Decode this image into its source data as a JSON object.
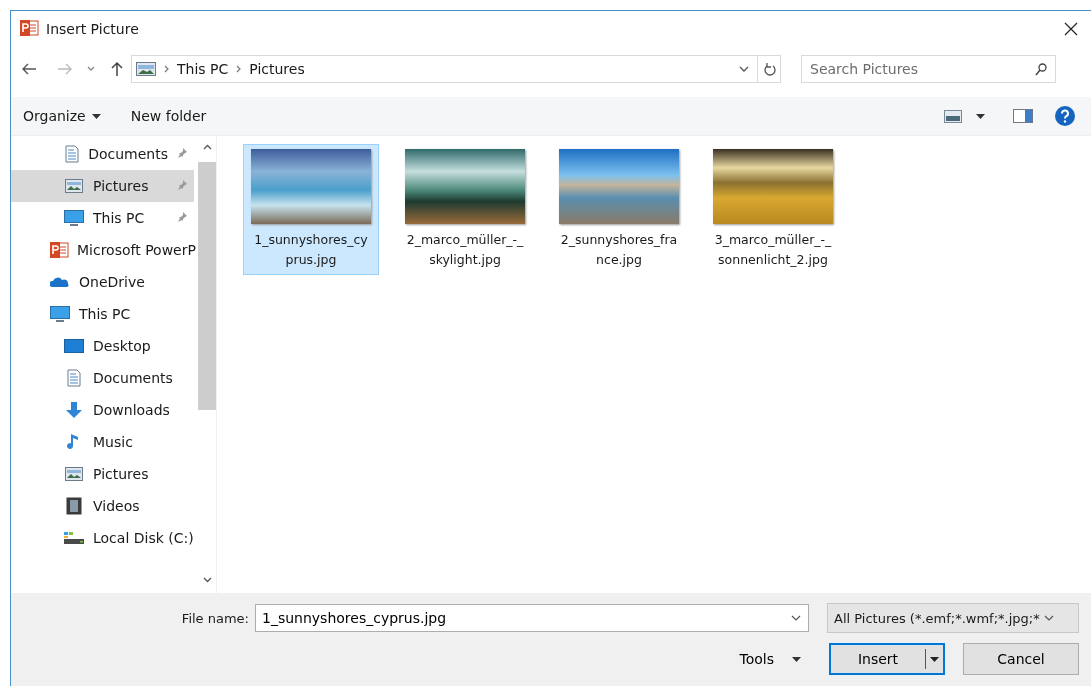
{
  "window": {
    "title": "Insert Picture"
  },
  "address": {
    "path": [
      "This PC",
      "Pictures"
    ]
  },
  "search": {
    "placeholder": "Search Pictures"
  },
  "toolbar": {
    "organize": "Organize",
    "new_folder": "New folder"
  },
  "sidebar": {
    "items": [
      {
        "children": [
          {
            "label": "Documents",
            "kind": "documents",
            "pinned": true,
            "selected": false
          },
          {
            "label": "Pictures",
            "kind": "pictures",
            "pinned": true,
            "selected": true
          },
          {
            "label": "This PC",
            "kind": "pc",
            "pinned": true,
            "selected": false
          }
        ]
      },
      {
        "label": "Microsoft PowerP",
        "kind": "powerpoint",
        "selected": false
      },
      {
        "label": "OneDrive",
        "kind": "onedrive",
        "selected": false
      },
      {
        "label": "This PC",
        "kind": "pc",
        "selected": false,
        "children": [
          {
            "label": "Desktop",
            "kind": "desktop",
            "selected": false
          },
          {
            "label": "Documents",
            "kind": "documents",
            "selected": false
          },
          {
            "label": "Downloads",
            "kind": "downloads",
            "selected": false
          },
          {
            "label": "Music",
            "kind": "music",
            "selected": false
          },
          {
            "label": "Pictures",
            "kind": "pictures",
            "selected": false
          },
          {
            "label": "Videos",
            "kind": "videos",
            "selected": false
          },
          {
            "label": "Local Disk (C:)",
            "kind": "disk",
            "selected": false
          }
        ]
      }
    ]
  },
  "files": [
    {
      "name": "1_sunnyshores_cyprus.jpg",
      "selected": true
    },
    {
      "name": "2_marco_müller_-_skylight.jpg",
      "selected": false
    },
    {
      "name": "2_sunnyshores_france.jpg",
      "selected": false
    },
    {
      "name": "3_marco_müller_-_sonnenlicht_2.jpg",
      "selected": false
    }
  ],
  "footer": {
    "file_name_label": "File name:",
    "file_name": "1_sunnyshores_cyprus.jpg",
    "filter": "All Pictures (*.emf;*.wmf;*.jpg;*",
    "tools": "Tools",
    "insert": "Insert",
    "cancel": "Cancel"
  }
}
